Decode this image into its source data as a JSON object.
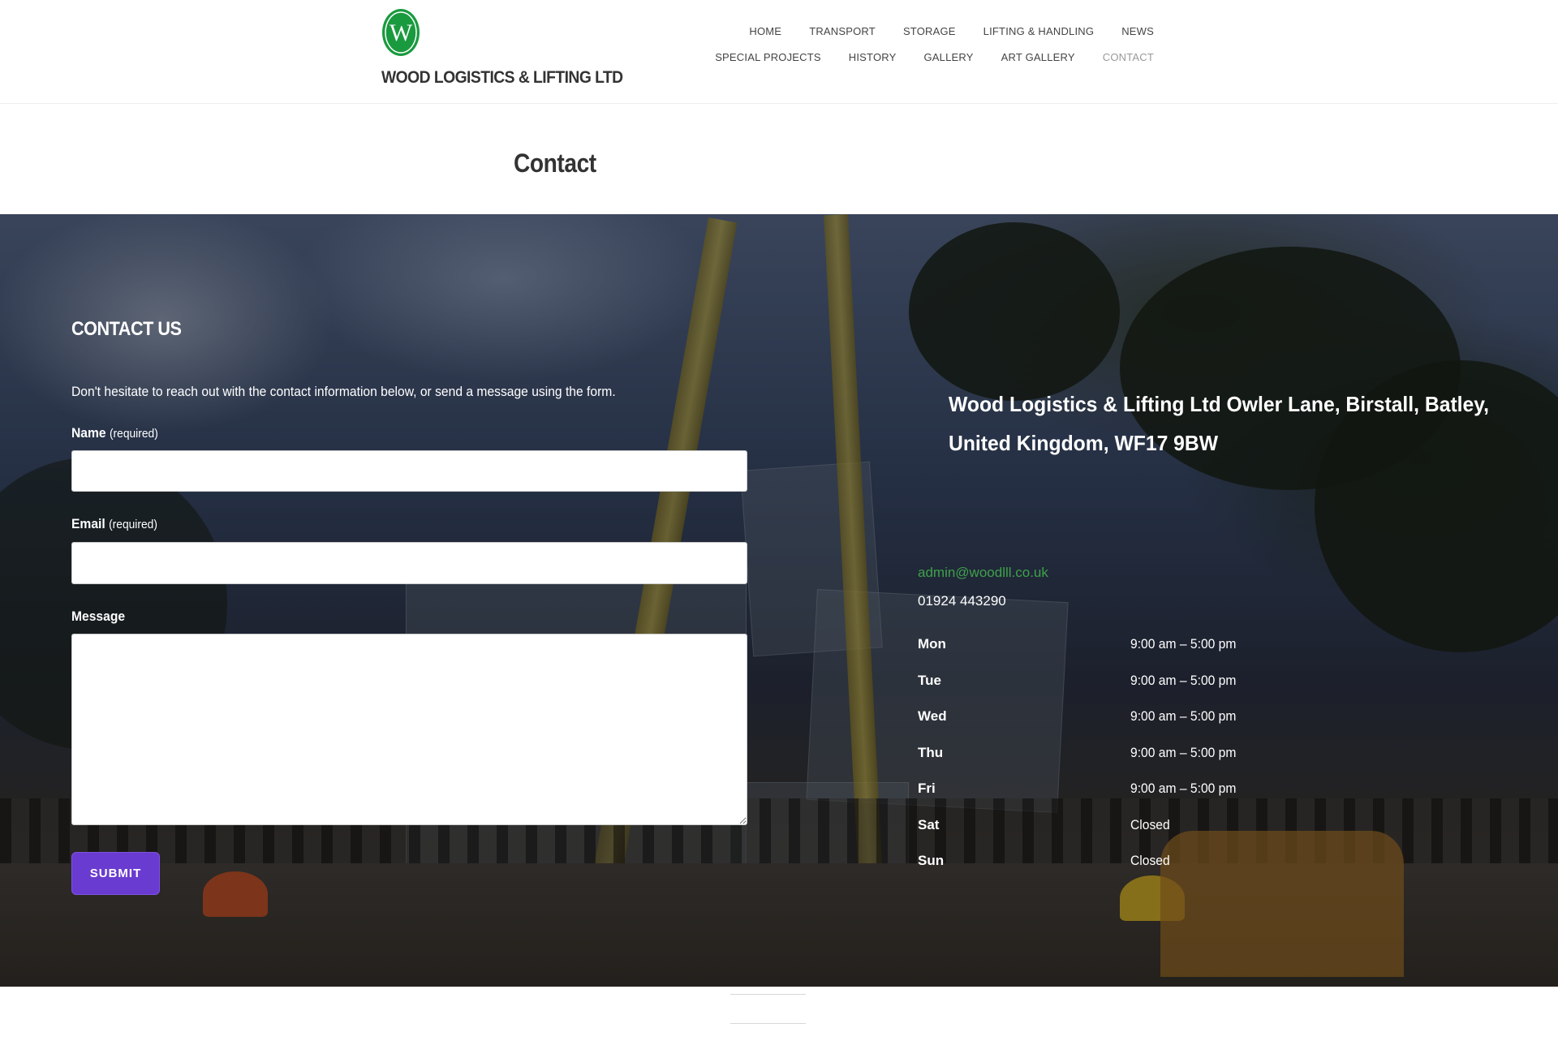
{
  "brand": {
    "logo_letter": "W",
    "name": "WOOD LOGISTICS & LIFTING LTD",
    "color": "#1a9a3f"
  },
  "nav": {
    "row1": [
      "HOME",
      "TRANSPORT",
      "STORAGE",
      "LIFTING & HANDLING",
      "NEWS"
    ],
    "row2": [
      "SPECIAL PROJECTS",
      "HISTORY",
      "GALLERY",
      "ART GALLERY",
      "CONTACT"
    ],
    "active": "CONTACT"
  },
  "page": {
    "title": "Contact"
  },
  "form": {
    "heading": "CONTACT US",
    "intro": "Don't hesitate to reach out with the contact information below, or send a message using the form.",
    "name_label": "Name",
    "email_label": "Email",
    "required_note": "(required)",
    "message_label": "Message",
    "name_value": "",
    "email_value": "",
    "message_value": "",
    "submit_label": "SUBMIT",
    "accent": "#6a3bd1"
  },
  "info": {
    "address": "Wood Logistics & Lifting Ltd Owler Lane, Birstall, Batley, United Kingdom, WF17 9BW",
    "email": "admin@woodlll.co.uk",
    "phone": "01924 443290",
    "link_color": "#3fa04a",
    "hours": [
      {
        "day": "Mon",
        "time": "9:00 am – 5:00 pm"
      },
      {
        "day": "Tue",
        "time": "9:00 am – 5:00 pm"
      },
      {
        "day": "Wed",
        "time": "9:00 am – 5:00 pm"
      },
      {
        "day": "Thu",
        "time": "9:00 am – 5:00 pm"
      },
      {
        "day": "Fri",
        "time": "9:00 am – 5:00 pm"
      },
      {
        "day": "Sat",
        "time": "Closed"
      },
      {
        "day": "Sun",
        "time": "Closed"
      }
    ]
  }
}
